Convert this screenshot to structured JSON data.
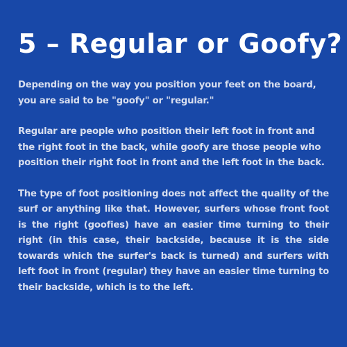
{
  "colors": {
    "background": "#1848a8",
    "title": "#ffffff",
    "body_text": "#d7deef"
  },
  "title": "5 – Regular or Goofy?",
  "paragraphs": [
    "Depending on the way you position your feet on the board, you are said to be \"goofy\" or \"regular.\"",
    "Regular are people who position their left foot in front and the right foot in the back, while goofy are those people who position their right foot in front and the left foot in the back.",
    "The type of foot positioning does not affect the quality of the surf or anything like that. However, surfers whose front foot is the right (goofies) have an easier time turning to their right (in this case, their backside, because it is the side towards which the surfer's back is turned) and surfers with left foot in front (regular) they have an easier time turning to their backside, which is to the left."
  ]
}
